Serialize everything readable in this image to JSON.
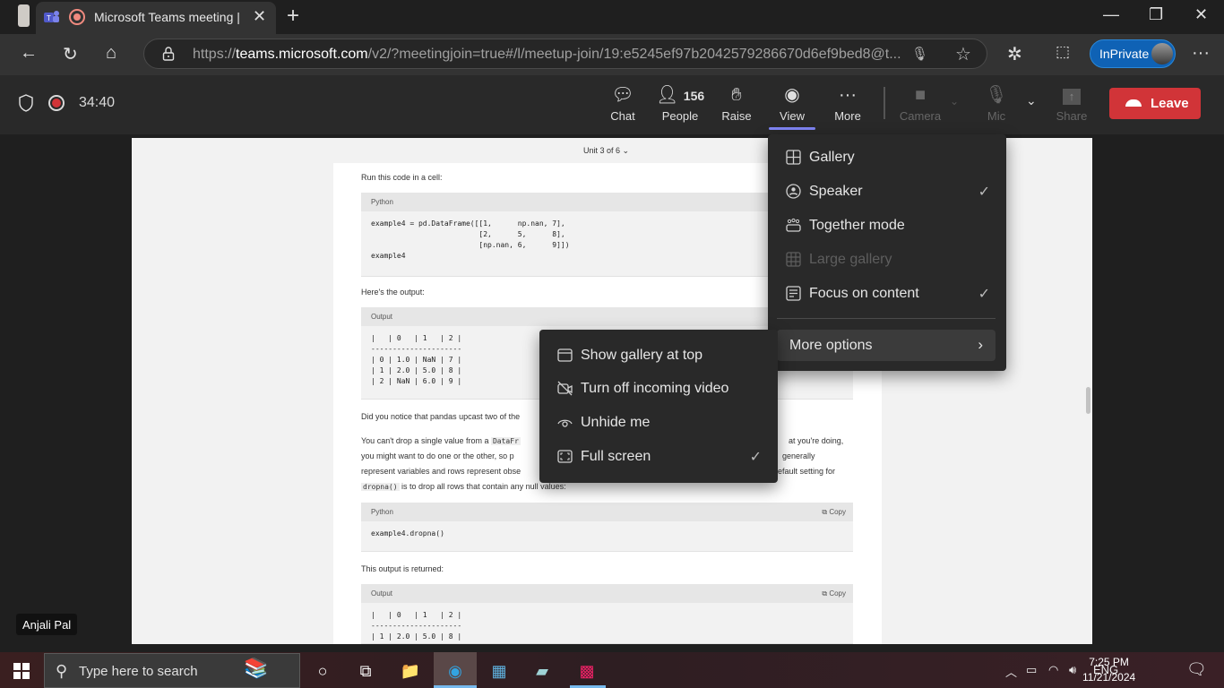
{
  "browser": {
    "tab_title": "Microsoft Teams meeting | Microsoft Teams",
    "new_tab": "+",
    "url_prefix": "https://",
    "url_domain": "teams.microsoft.com",
    "url_path": "/v2/?meetingjoin=true#/l/meetup-join/19:e5245ef97b2042579286670d6ef9bed8@t...",
    "inprivate_label": "InPrivate"
  },
  "meeting": {
    "timer": "34:40",
    "toolbar": [
      {
        "id": "chat",
        "label": "Chat",
        "icon": "chat-icon"
      },
      {
        "id": "people",
        "label": "People",
        "icon": "people-icon",
        "count": "156"
      },
      {
        "id": "raise",
        "label": "Raise",
        "icon": "raise-hand-icon"
      },
      {
        "id": "view",
        "label": "View",
        "icon": "view-icon",
        "active": true
      },
      {
        "id": "more",
        "label": "More",
        "icon": "more-icon"
      },
      {
        "id": "camera",
        "label": "Camera",
        "icon": "camera-off-icon",
        "disabled": true
      },
      {
        "id": "mic",
        "label": "Mic",
        "icon": "mic-off-icon",
        "disabled": true
      },
      {
        "id": "share",
        "label": "Share",
        "icon": "share-icon",
        "disabled": true
      }
    ],
    "leave_label": "Leave",
    "participant_name": "Anjali Pal"
  },
  "view_menu": {
    "items": [
      {
        "label": "Gallery",
        "icon": "gallery-icon",
        "checked": false,
        "disabled": false
      },
      {
        "label": "Speaker",
        "icon": "speaker-icon",
        "checked": true,
        "disabled": false
      },
      {
        "label": "Together mode",
        "icon": "together-mode-icon",
        "checked": false,
        "disabled": false
      },
      {
        "label": "Large gallery",
        "icon": "large-gallery-icon",
        "checked": false,
        "disabled": true
      },
      {
        "label": "Focus on content",
        "icon": "focus-content-icon",
        "checked": true,
        "disabled": false
      }
    ],
    "more_options_label": "More options",
    "check_glyph": "✓"
  },
  "more_options_menu": {
    "items": [
      {
        "label": "Show gallery at top",
        "icon": "gallery-top-icon",
        "checked": false
      },
      {
        "label": "Turn off incoming video",
        "icon": "video-off-icon",
        "checked": false
      },
      {
        "label": "Unhide me",
        "icon": "eye-icon",
        "checked": false
      },
      {
        "label": "Full screen",
        "icon": "full-screen-icon",
        "checked": true
      }
    ]
  },
  "shared_content": {
    "unit_label": "Unit 3 of 6",
    "intro": "Run this code in a cell:",
    "code1_lang": "Python",
    "code1": "example4 = pd.DataFrame([[1,      np.nan, 7],\n                         [2,      5,      8],\n                         [np.nan, 6,      9]])\nexample4",
    "output_intro": "Here's the output:",
    "output1_label": "Output",
    "output1": "|   | 0   | 1   | 2 |\n---------------------\n| 0 | 1.0 | NaN | 7 |\n| 1 | 2.0 | 5.0 | 8 |\n| 2 | NaN | 6.0 | 9 |",
    "para1": "Did you notice that pandas upcast two of the",
    "para2_a": "You can't drop a single value from a ",
    "para2_code": "DataFr",
    "para2_b": "at you're doing,",
    "para3_a": "you might want to do one or the other, so p",
    "para3_b": "generally",
    "para4_a": "represent variables and rows represent obse",
    "para4_b": "efault setting for",
    "para5_code": "dropna()",
    "para5": " is to drop all rows that contain any null values:",
    "code2_lang": "Python",
    "copy_label": "Copy",
    "code2": "example4.dropna()",
    "returned": "This output is returned:",
    "output2_label": "Output",
    "output2": "|   | 0   | 1   | 2 |\n---------------------\n| 1 | 2.0 | 5.0 | 8 |"
  },
  "taskbar": {
    "search_placeholder": "Type here to search",
    "lang": "ENG",
    "time": "7:25 PM",
    "date": "11/21/2024"
  }
}
